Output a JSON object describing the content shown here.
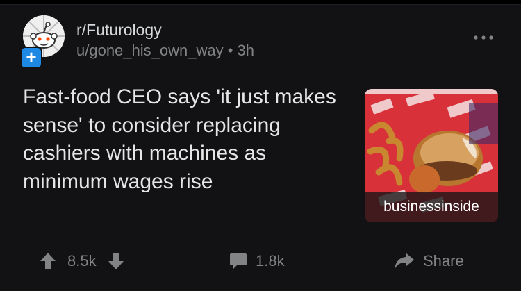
{
  "post": {
    "subreddit": "r/Futurology",
    "author_line": "u/gone_his_own_way • 3h",
    "title": "Fast-food CEO says 'it just makes sense' to consider replacing cashiers with machines as minimum wages rise",
    "thumbnail_source": "businessinside"
  },
  "actions": {
    "score": "8.5k",
    "comments": "1.8k",
    "share_label": "Share"
  },
  "icons": {
    "avatar": "reddit-snoo-avatar",
    "join": "plus-icon",
    "more": "more-dots-icon",
    "upvote": "upvote-arrow-icon",
    "downvote": "downvote-arrow-icon",
    "comment": "comment-bubble-icon",
    "share": "share-arrow-icon"
  },
  "colors": {
    "background": "#121214",
    "accent_join": "#1e88e5",
    "muted_text": "#818384",
    "title_text": "#e6e6e6"
  }
}
